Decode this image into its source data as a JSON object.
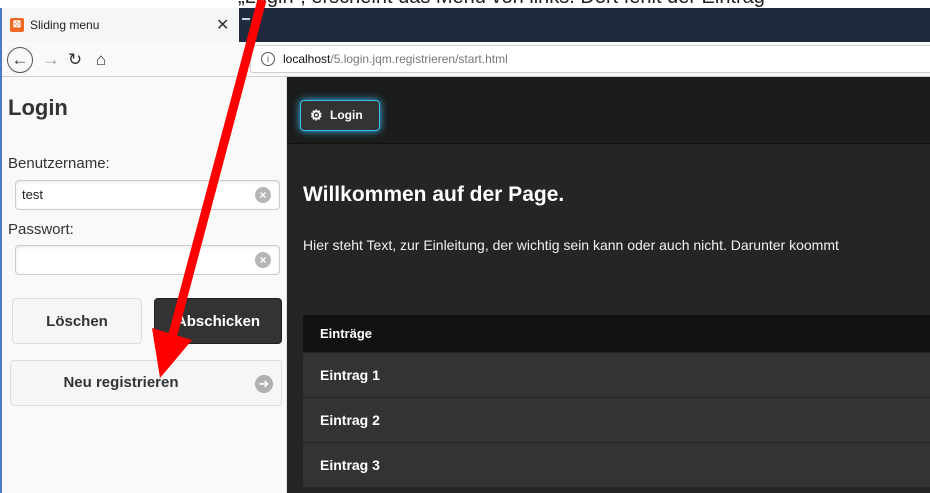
{
  "caption": {
    "text": "„Login“, erscheint das Menü von links. Dort fehlt der Eintrag"
  },
  "browser": {
    "tab_title": "Sliding menu",
    "tab_favicon": "xampp-logo",
    "url_host": "localhost",
    "url_path": "/5.login.jqm.registrieren/start.html"
  },
  "panel": {
    "title": "Login",
    "username_label": "Benutzername:",
    "username_value": "test",
    "password_label": "Passwort:",
    "password_value": "",
    "clear_button": "Löschen",
    "submit_button": "Abschicken",
    "register_button": "Neu registrieren"
  },
  "main": {
    "header_button": "Login",
    "welcome": "Willkommen auf der Page.",
    "intro": "Hier steht Text, zur Einleitung, der wichtig sein kann oder auch nicht. Darunter koommt",
    "list_header": "Einträge",
    "items": [
      "Eintrag 1",
      "Eintrag 2",
      "Eintrag 3"
    ]
  },
  "colors": {
    "annotation_arrow": "#ff0000",
    "login_glow": "#38c0f0",
    "dark_bg": "#252525"
  }
}
